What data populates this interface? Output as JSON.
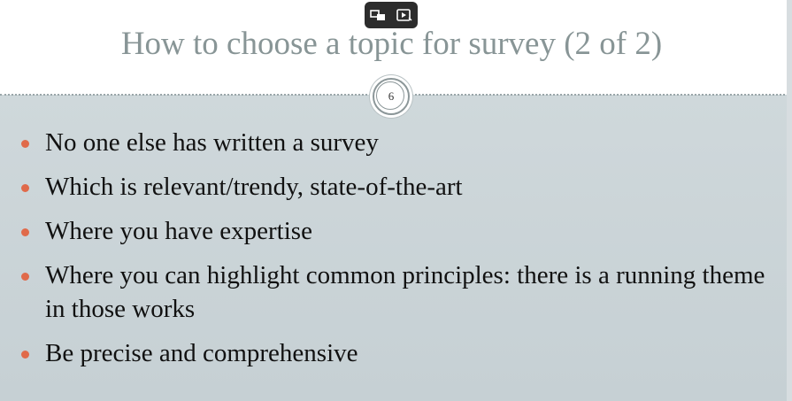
{
  "slide": {
    "title": "How to choose a topic for survey (2 of 2)",
    "slide_number": "6",
    "bullets": [
      "No one else has written a survey",
      "Which is relevant/trendy, state-of-the-art",
      "Where you have expertise",
      "Where you can highlight common principles: there is a running theme in those works",
      "Be precise and comprehensive"
    ]
  },
  "overlay_controls": {
    "icons": [
      "swap-screens-icon",
      "present-icon"
    ]
  },
  "colors": {
    "title_text": "#889596",
    "bullet_marker": "#e06a4a",
    "body_background": "#c9d2d6",
    "title_background": "#ffffff"
  }
}
